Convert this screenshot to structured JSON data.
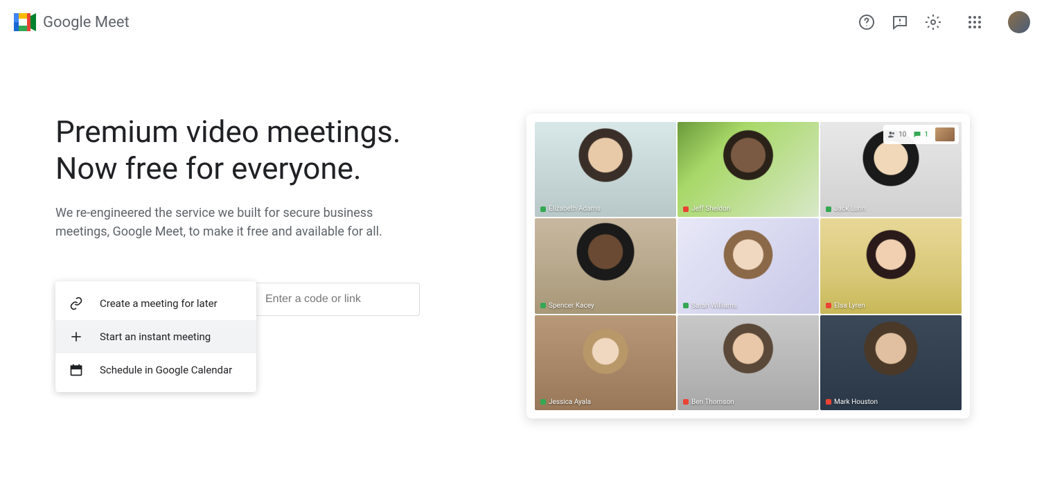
{
  "brand": {
    "google": "Google",
    "meet": "Meet"
  },
  "hero": {
    "headline_line1": "Premium video meetings.",
    "headline_line2": "Now free for everyone.",
    "subtext": "We re-engineered the service we built for secure business meetings, Google Meet, to make it free and available for all."
  },
  "input": {
    "placeholder": "Enter a code or link"
  },
  "dropdown": {
    "items": [
      {
        "label": "Create a meeting for later",
        "icon": "link-icon"
      },
      {
        "label": "Start an instant meeting",
        "icon": "plus-icon"
      },
      {
        "label": "Schedule in Google Calendar",
        "icon": "calendar-icon"
      }
    ],
    "hovered_index": 1
  },
  "preview": {
    "participant_count": "10",
    "chat_badge": "1",
    "participants": [
      {
        "name": "Elizabeth Adams",
        "status_color": "#34a853"
      },
      {
        "name": "Jeff Sheldon",
        "status_color": "#ea4335"
      },
      {
        "name": "Jack Lunn",
        "status_color": "#34a853"
      },
      {
        "name": "Spencer Kacey",
        "status_color": "#34a853"
      },
      {
        "name": "Sarah Williams",
        "status_color": "#34a853"
      },
      {
        "name": "Elsa Lyren",
        "status_color": "#ea4335"
      },
      {
        "name": "Jessica Ayala",
        "status_color": "#34a853"
      },
      {
        "name": "Ben Thomson",
        "status_color": "#ea4335"
      },
      {
        "name": "Mark Houston",
        "status_color": "#ea4335"
      }
    ]
  }
}
